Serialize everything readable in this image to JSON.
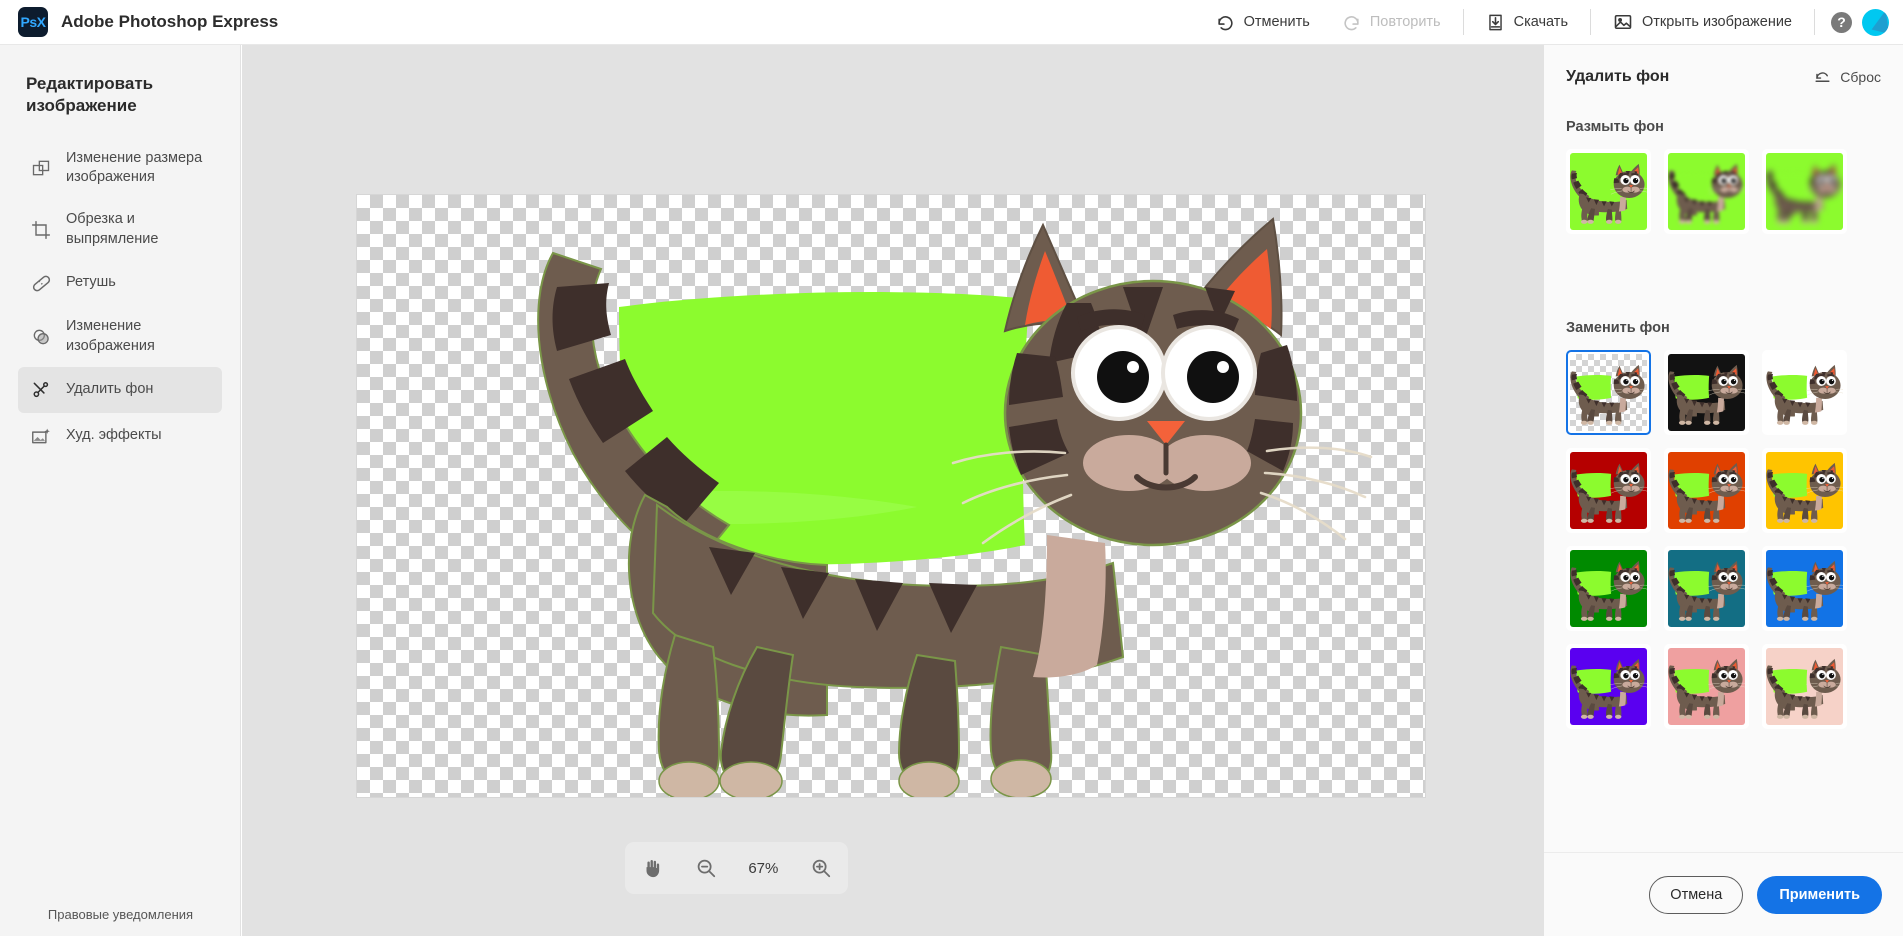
{
  "app": {
    "logo_text": "PsX",
    "title": "Adobe Photoshop Express"
  },
  "toolbar": {
    "undo_label": "Отменить",
    "redo_label": "Повторить",
    "download_label": "Скачать",
    "open_image_label": "Открыть изображение",
    "help_glyph": "?",
    "icons": {
      "undo": "undo-arrow-icon",
      "redo": "redo-arrow-icon",
      "download": "download-icon",
      "open_image": "picture-icon",
      "help": "help-circle-icon",
      "avatar": "user-avatar"
    }
  },
  "sidebar": {
    "title": "Редактировать изображение",
    "items": [
      {
        "label": "Изменение размера изображения",
        "icon": "resize-icon",
        "active": false
      },
      {
        "label": "Обрезка и выпрямление",
        "icon": "crop-icon",
        "active": false
      },
      {
        "label": "Ретушь",
        "icon": "bandage-icon",
        "active": false
      },
      {
        "label": "Изменение изображения",
        "icon": "adjust-icon",
        "active": false
      },
      {
        "label": "Удалить фон",
        "icon": "scissors-icon",
        "active": true
      },
      {
        "label": "Худ. эффекты",
        "icon": "effects-icon",
        "active": false
      }
    ],
    "legal_label": "Правовые уведомления"
  },
  "canvas": {
    "background": "transparent-checkerboard",
    "subject": "cat-illustration",
    "leftover_color": "#8CFB2E",
    "colors": {
      "fur_body": "#6e5c4e",
      "fur_dark": "#3e2f2b",
      "fur_mid": "#5a4a40",
      "ear_inner": "#ef5b33",
      "nose": "#f4623a",
      "muzzle": "#c9aa9c",
      "paw": "#cfb7a4",
      "eye_white": "#ffffff",
      "eye_ring": "#e9e5e1",
      "pupil": "#101010"
    }
  },
  "zoom_bar": {
    "hand_icon": "hand-icon",
    "zoom_out_icon": "zoom-out-icon",
    "zoom_in_icon": "zoom-in-icon",
    "zoom_level": "67%"
  },
  "right_panel": {
    "title": "Удалить фон",
    "reset_label": "Сброс",
    "reset_icon": "reset-arrow-icon",
    "blur_section_label": "Размыть фон",
    "replace_section_label": "Заменить фон",
    "blur_options": [
      {
        "name": "blur-none",
        "level": 0,
        "bg": "#8CFB2E",
        "selected": false
      },
      {
        "name": "blur-low",
        "level": 1,
        "bg": "#8CFB2E",
        "selected": false
      },
      {
        "name": "blur-high",
        "level": 2,
        "bg": "#8CFB2E",
        "selected": false
      }
    ],
    "replace_options": [
      {
        "name": "transparent",
        "bg": "checker",
        "selected": true
      },
      {
        "name": "black",
        "bg": "#121212",
        "selected": false
      },
      {
        "name": "white",
        "bg": "#ffffff",
        "selected": false
      },
      {
        "name": "dark-red",
        "bg": "#b50000",
        "selected": false
      },
      {
        "name": "orange-red",
        "bg": "#e04000",
        "selected": false
      },
      {
        "name": "gold",
        "bg": "#ffc400",
        "selected": false
      },
      {
        "name": "green",
        "bg": "#008a00",
        "selected": false
      },
      {
        "name": "teal",
        "bg": "#136e84",
        "selected": false
      },
      {
        "name": "blue",
        "bg": "#1273e6",
        "selected": false
      },
      {
        "name": "violet",
        "bg": "#5a00f0",
        "selected": false
      },
      {
        "name": "salmon",
        "bg": "#efa0a0",
        "selected": false
      },
      {
        "name": "light-pink",
        "bg": "#f6d2c8",
        "selected": false
      }
    ],
    "cancel_label": "Отмена",
    "apply_label": "Применить",
    "accent_color": "#1473e6"
  }
}
